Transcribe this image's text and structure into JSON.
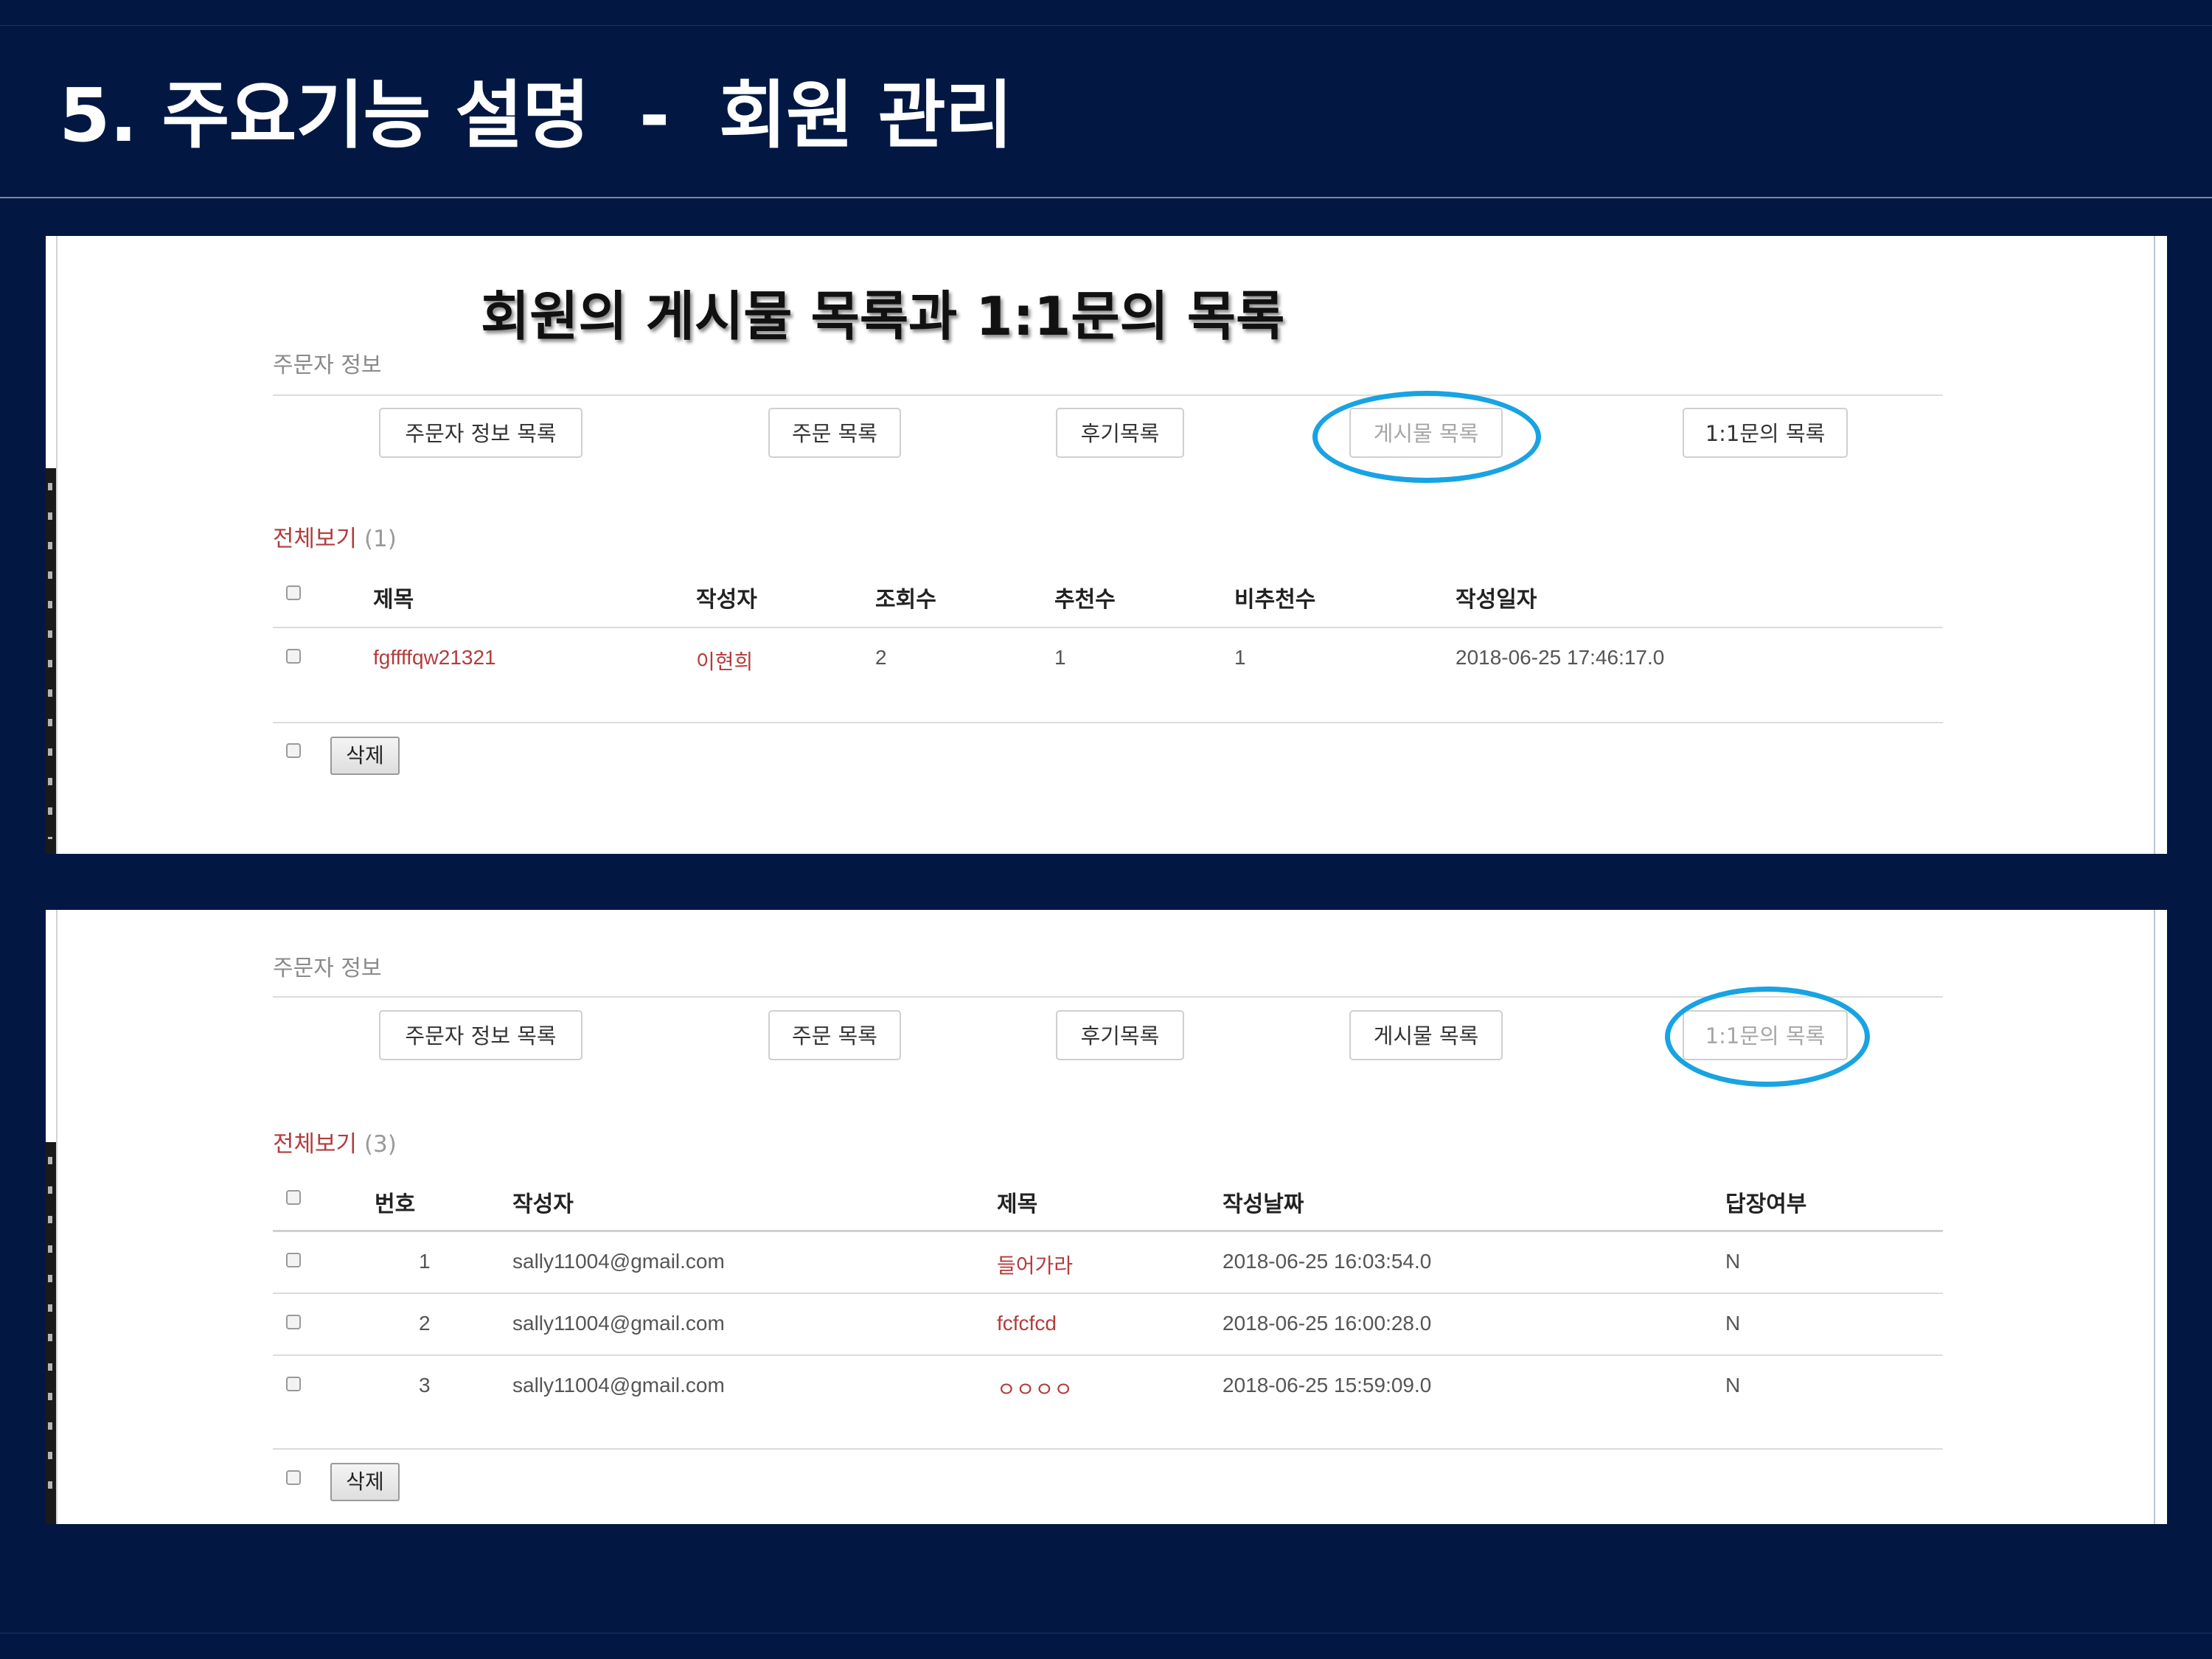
{
  "slide": {
    "title": "5. 주요기능 설명  -  회원 관리"
  },
  "panel1": {
    "heading": "회원의 게시물 목록과 1:1문의 목록",
    "section_label": "주문자 정보",
    "tabs": [
      "주문자 정보 목록",
      "주문 목록",
      "후기목록",
      "게시물 목록",
      "1:1문의 목록"
    ],
    "active_tab": "게시물 목록",
    "view_all_label": "전체보기",
    "view_all_count": "(1)",
    "columns": [
      "제목",
      "작성자",
      "조회수",
      "추천수",
      "비추천수",
      "작성일자"
    ],
    "rows": [
      [
        "fgffffqw21321",
        "이현희",
        "2",
        "1",
        "1",
        "2018-06-25 17:46:17.0"
      ]
    ],
    "delete_label": "삭제"
  },
  "panel2": {
    "section_label": "주문자 정보",
    "tabs": [
      "주문자 정보 목록",
      "주문 목록",
      "후기목록",
      "게시물 목록",
      "1:1문의 목록"
    ],
    "active_tab": "1:1문의 목록",
    "view_all_label": "전체보기",
    "view_all_count": "(3)",
    "columns": [
      "번호",
      "작성자",
      "제목",
      "작성날짜",
      "답장여부"
    ],
    "rows": [
      [
        "1",
        "sally11004@gmail.com",
        "들어가라",
        "2018-06-25 16:03:54.0",
        "N"
      ],
      [
        "2",
        "sally11004@gmail.com",
        "fcfcfcd",
        "2018-06-25 16:00:28.0",
        "N"
      ],
      [
        "3",
        "sally11004@gmail.com",
        "ㅇㅇㅇㅇ",
        "2018-06-25 15:59:09.0",
        "N"
      ]
    ],
    "delete_label": "삭제"
  },
  "colors": {
    "slide_background": "#021843",
    "link_red": "#b33c3c",
    "highlight_ring": "#18a3e2"
  }
}
